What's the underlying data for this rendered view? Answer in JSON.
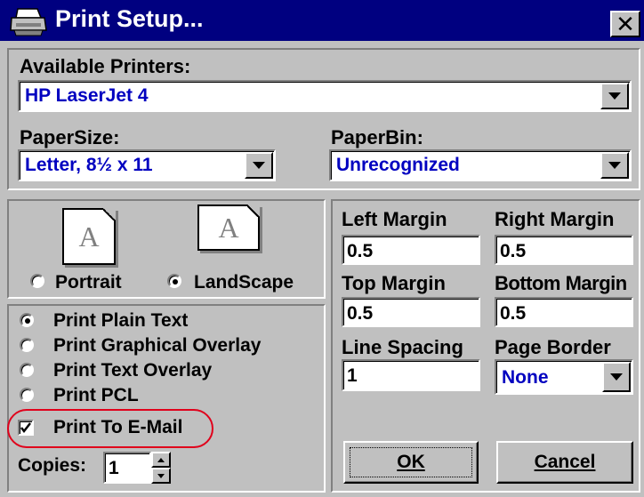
{
  "window": {
    "title": "Print Setup...",
    "close_label": "✕"
  },
  "printers": {
    "label": "Available Printers:",
    "selected": "HP LaserJet 4"
  },
  "paper_size": {
    "label": "PaperSize:",
    "selected": "Letter, 8½ x 11"
  },
  "paper_bin": {
    "label": "PaperBin:",
    "selected": "Unrecognized"
  },
  "orientation": {
    "portrait_label": "Portrait",
    "landscape_label": "LandScape",
    "icon_letter": "A",
    "selected": "LandScape"
  },
  "print_mode": {
    "options": [
      "Print Plain Text",
      "Print Graphical Overlay",
      "Print Text Overlay",
      "Print PCL"
    ],
    "selected": "Print Plain Text"
  },
  "email": {
    "label": "Print To E-Mail",
    "checked": true
  },
  "copies": {
    "label": "Copies:",
    "value": "1"
  },
  "margins": {
    "left_label": "Left Margin",
    "left_value": "0.5",
    "right_label": "Right Margin",
    "right_value": "0.5",
    "top_label": "Top Margin",
    "top_value": "0.5",
    "bottom_label": "Bottom Margin",
    "bottom_value": "0.5"
  },
  "line_spacing": {
    "label": "Line Spacing",
    "value": "1"
  },
  "page_border": {
    "label": "Page Border",
    "selected": "None"
  },
  "buttons": {
    "ok": "OK",
    "cancel": "Cancel"
  },
  "colors": {
    "titlebar": "#000080",
    "face": "#c0c0c0",
    "combo_text": "#0000c0",
    "highlight": "#e0001b"
  }
}
